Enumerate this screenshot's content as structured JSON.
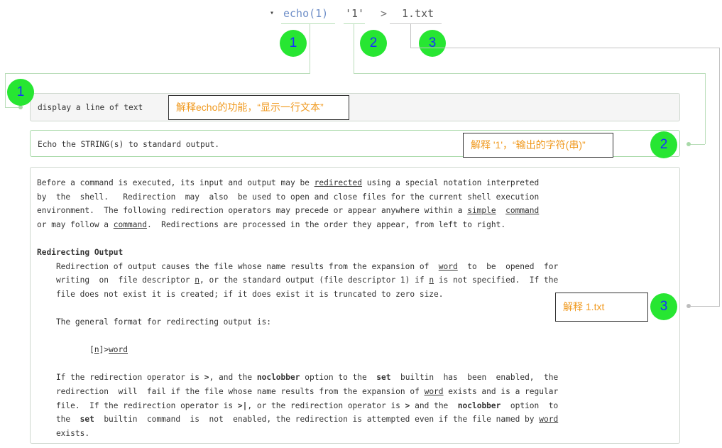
{
  "command": {
    "toggle_icon": "▾",
    "name": "echo(1)",
    "arg": "'1'",
    "redirect": ">",
    "file": "1.txt"
  },
  "badges": {
    "b1": "1",
    "b2": "2",
    "b3": "3"
  },
  "sections": {
    "echo_desc": "display a line of text",
    "arg_desc": "Echo the STRING(s) to standard output.",
    "redirect": {
      "l1_a": "Before a command is executed, its input and output may be ",
      "l1_link": "redirected",
      "l1_b": " using a special notation interpreted",
      "l2": "by  the  shell.   Redirection  may  also  be used to open and close files for the current shell execution",
      "l3_a": "environment.  The following redirection operators may precede or appear anywhere within a ",
      "l3_link1": "simple",
      "l3_sp": "  ",
      "l3_link2": "command",
      "l4_a": "or may follow a ",
      "l4_link": "command",
      "l4_b": ".  Redirections are processed in the order they appear, from left to right.",
      "heading": "Redirecting Output",
      "p1_l1_a": "    Redirection of output causes the file whose name results from the expansion of  ",
      "p1_l1_link": "word",
      "p1_l1_b": "  to  be  opened  for",
      "p1_l2_a": "    writing  on  file descriptor ",
      "p1_l2_n1": "n",
      "p1_l2_b": ", or the standard output (file descriptor 1) if ",
      "p1_l2_n2": "n",
      "p1_l2_c": " is not specified.  If the",
      "p1_l3": "    file does not exist it is created; if it does exist it is truncated to zero size.",
      "p2": "    The general format for redirecting output is:",
      "fmt_a": "           [",
      "fmt_n": "n",
      "fmt_b": "]>",
      "fmt_word": "word",
      "p3_l1_a": "    If the redirection operator is ",
      "p3_l1_gt": ">",
      "p3_l1_b": ", and the ",
      "p3_l1_noclobber": "noclobber",
      "p3_l1_c": " option to the  ",
      "p3_l1_set": "set",
      "p3_l1_d": "  builtin  has  been  enabled,  the",
      "p3_l2_a": "    redirection  will  fail if the file whose name results from the expansion of ",
      "p3_l2_word": "word",
      "p3_l2_b": " exists and is a regular",
      "p3_l3_a": "    file.  If the redirection operator is ",
      "p3_l3_op": ">|",
      "p3_l3_b": ", or the redirection operator is ",
      "p3_l3_gt": ">",
      "p3_l3_c": " and the  ",
      "p3_l3_noclobber": "noclobber",
      "p3_l3_d": "  option  to",
      "p3_l4_a": "    the  ",
      "p3_l4_set": "set",
      "p3_l4_b": "  builtin  command  is  not  enabled, the redirection is attempted even if the file named by ",
      "p3_l4_word": "word",
      "p3_l5": "    exists."
    }
  },
  "annotations": {
    "n1": "解释echo的功能，“显示一行文本”",
    "n2": "解释 '1'，“输出的字符(串)”",
    "n3": "解释 1.txt"
  },
  "colors": {
    "badge": "#27e632",
    "badge_text": "#1530ff",
    "note_text": "#f09a20",
    "connector": "#b9ddb9",
    "command_name": "#6f8fc8"
  }
}
